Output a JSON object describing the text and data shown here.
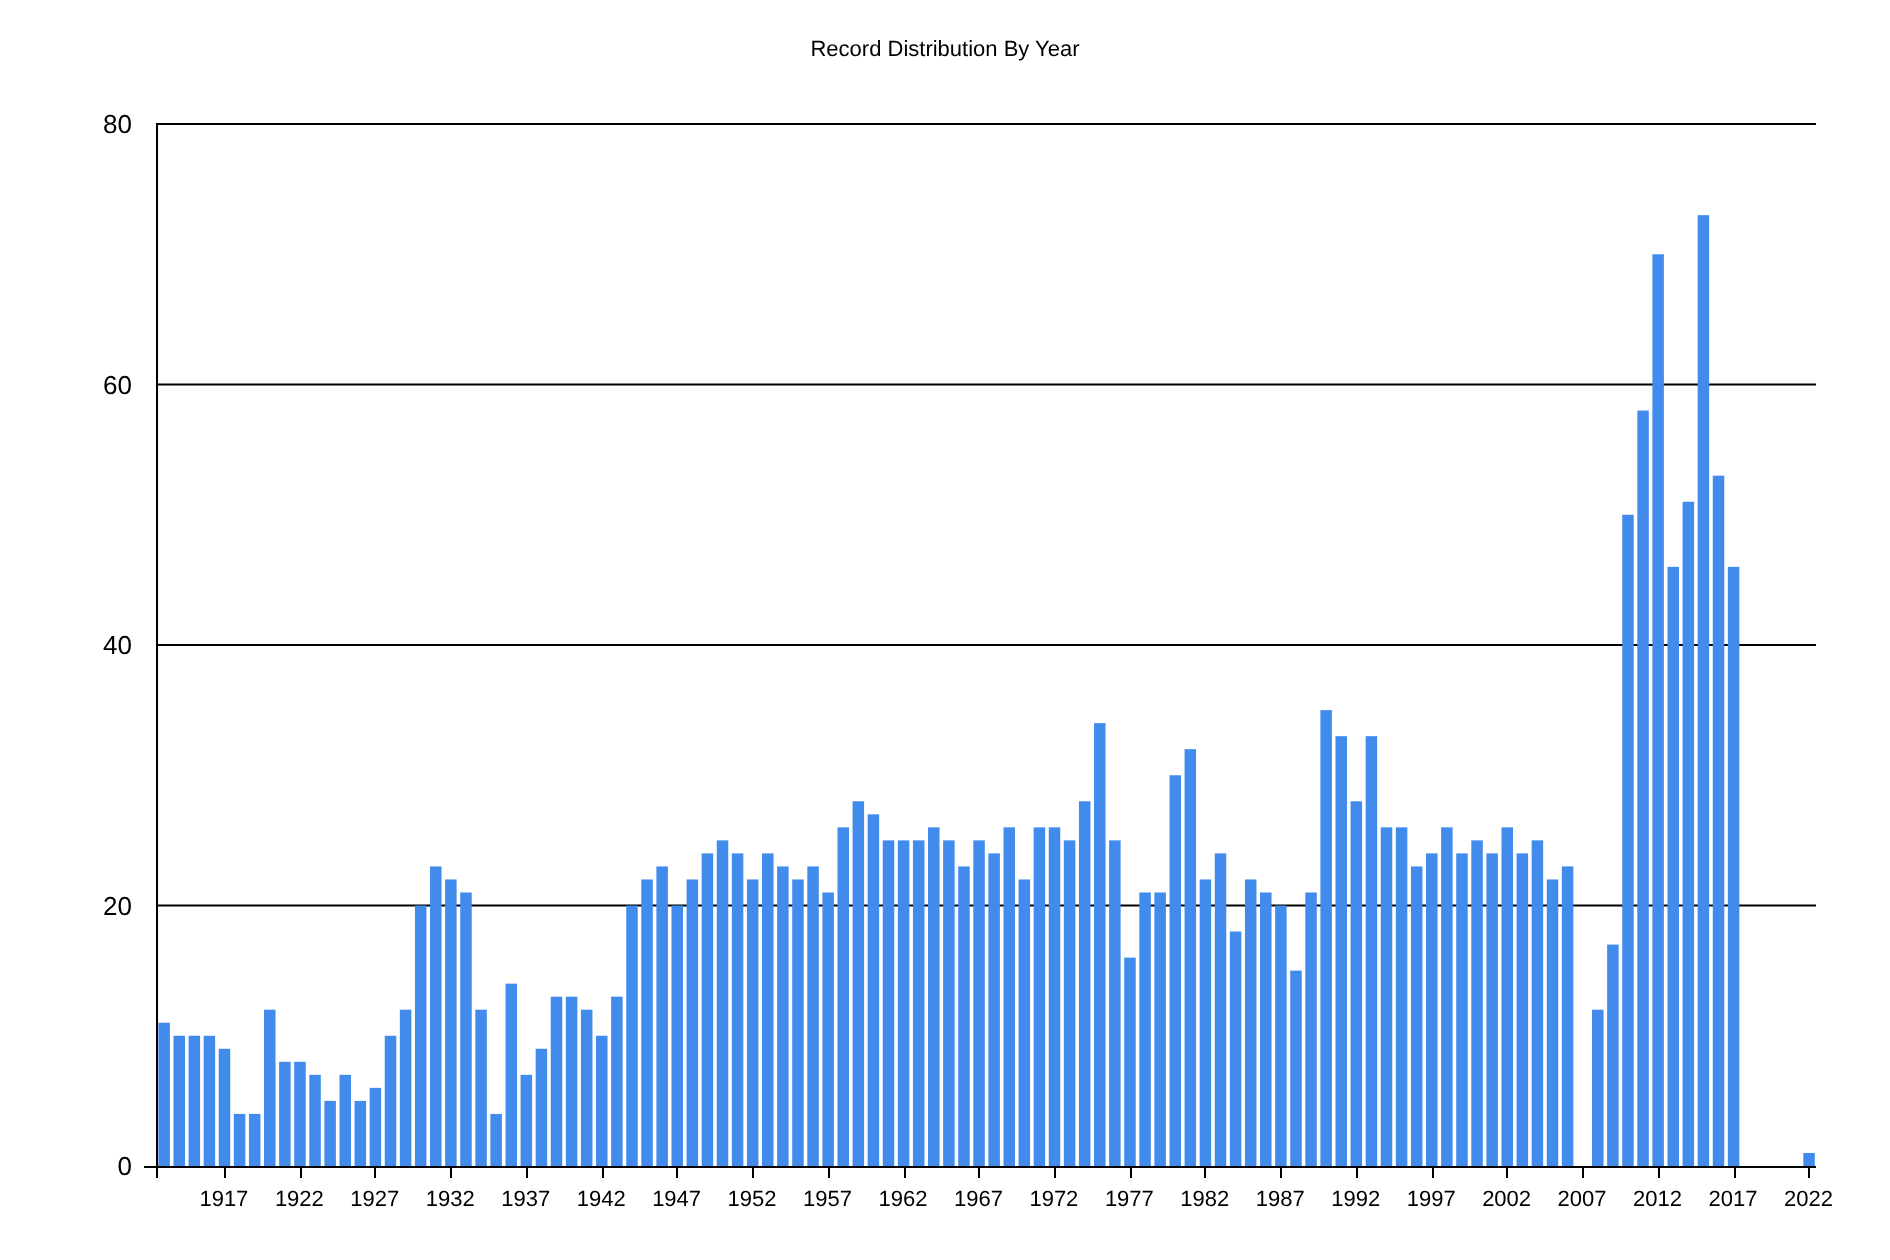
{
  "chart_data": {
    "type": "bar",
    "title": "Record Distribution By Year",
    "x": [
      1913,
      1914,
      1915,
      1916,
      1917,
      1918,
      1919,
      1920,
      1921,
      1922,
      1923,
      1924,
      1925,
      1926,
      1927,
      1928,
      1929,
      1930,
      1931,
      1932,
      1933,
      1934,
      1935,
      1936,
      1937,
      1938,
      1939,
      1940,
      1941,
      1942,
      1943,
      1944,
      1945,
      1946,
      1947,
      1948,
      1949,
      1950,
      1951,
      1952,
      1953,
      1954,
      1955,
      1956,
      1957,
      1958,
      1959,
      1960,
      1961,
      1962,
      1963,
      1964,
      1965,
      1966,
      1967,
      1968,
      1969,
      1970,
      1971,
      1972,
      1973,
      1974,
      1975,
      1976,
      1977,
      1978,
      1979,
      1980,
      1981,
      1982,
      1983,
      1984,
      1985,
      1986,
      1987,
      1988,
      1989,
      1990,
      1991,
      1992,
      1993,
      1994,
      1995,
      1996,
      1997,
      1998,
      1999,
      2000,
      2001,
      2002,
      2003,
      2004,
      2005,
      2006,
      2008,
      2009,
      2010,
      2011,
      2012,
      2013,
      2014,
      2015,
      2016,
      2017,
      2022
    ],
    "series": [
      {
        "color": "#418bed",
        "values": [
          11,
          10,
          10,
          10,
          9,
          4,
          4,
          12,
          8,
          8,
          7,
          5,
          7,
          5,
          6,
          10,
          12,
          20,
          23,
          22,
          21,
          12,
          4,
          14,
          7,
          9,
          13,
          13,
          12,
          10,
          13,
          20,
          22,
          23,
          20,
          22,
          24,
          25,
          24,
          22,
          24,
          23,
          22,
          23,
          21,
          26,
          28,
          27,
          25,
          25,
          25,
          26,
          25,
          23,
          25,
          24,
          26,
          22,
          26,
          26,
          25,
          28,
          34,
          25,
          16,
          21,
          21,
          30,
          32,
          22,
          24,
          18,
          22,
          21,
          20,
          15,
          21,
          35,
          33,
          28,
          33,
          26,
          26,
          23,
          24,
          26,
          24,
          25,
          24,
          26,
          24,
          25,
          22,
          23,
          12,
          17,
          50,
          58,
          70,
          46,
          51,
          73,
          53,
          46,
          1
        ]
      }
    ],
    "xlim": [
      1912.5,
      2022.5
    ],
    "ylim": [
      0,
      80
    ],
    "yticks": [
      0,
      20,
      40,
      60,
      80
    ],
    "xticks": [
      1917,
      1922,
      1927,
      1932,
      1937,
      1942,
      1947,
      1952,
      1957,
      1962,
      1967,
      1972,
      1977,
      1982,
      1987,
      1992,
      1997,
      2002,
      2007,
      2012,
      2017,
      2022
    ],
    "grid": true
  }
}
